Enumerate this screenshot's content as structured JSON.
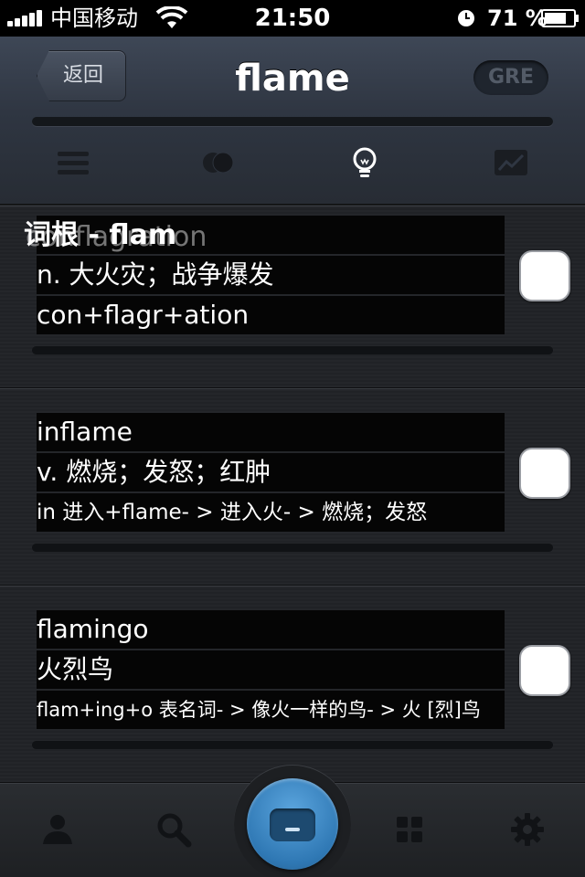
{
  "status_bar": {
    "carrier": "中国移动",
    "time": "21:50",
    "battery_percent": "71 %"
  },
  "nav": {
    "back_label": "返回",
    "title": "flame",
    "badge": "GRE",
    "toolbar": [
      "list-icon",
      "overlap-circles-icon",
      "lightbulb-icon",
      "chart-icon"
    ]
  },
  "root": {
    "header": "词根 - flam",
    "ghost_text": "conflagration"
  },
  "cards": [
    {
      "word": "",
      "meaning": "n. 大火灾；战争爆发",
      "etymology": "con+flagr+ation"
    },
    {
      "word": "inflame",
      "meaning": " v. 燃烧；发怒；红肿",
      "etymology": "in 进入+flame- > 进入火- > 燃烧；发怒"
    },
    {
      "word": "flamingo",
      "meaning": "  火烈鸟",
      "etymology": "flam+ing+o 表名词- > 像火一样的鸟- > 火 [烈]鸟"
    }
  ],
  "tab_bar": {
    "items": [
      "person-icon",
      "search-icon",
      "card-icon",
      "grid-icon",
      "gear-icon"
    ],
    "active_color": "#3f8ccb"
  },
  "colors": {
    "accent": "#3f8ccb",
    "nav_top": "#3e4756",
    "background": "#222428"
  }
}
